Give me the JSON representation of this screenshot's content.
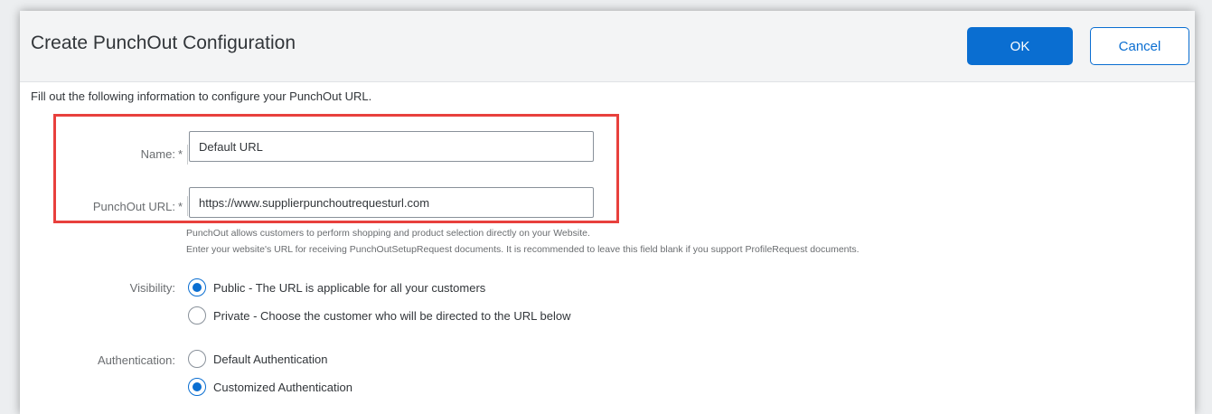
{
  "dialog": {
    "title": "Create PunchOut Configuration",
    "ok_label": "OK",
    "cancel_label": "Cancel"
  },
  "intro_text": "Fill out the following information to configure your PunchOut URL.",
  "form": {
    "required_marker": "*",
    "name": {
      "label": "Name:",
      "value": "Default URL"
    },
    "punchout_url": {
      "label": "PunchOut URL:",
      "value": "https://www.supplierpunchoutrequesturl.com",
      "help_line1": "PunchOut allows customers to perform shopping and product selection directly on your Website.",
      "help_line2": "Enter your website's URL for receiving PunchOutSetupRequest documents. It is recommended to leave this field blank if you support ProfileRequest documents."
    },
    "visibility": {
      "label": "Visibility:",
      "options": [
        {
          "label": "Public - The URL is applicable for all your customers",
          "selected": true
        },
        {
          "label": "Private - Choose the customer who will be directed to the URL below",
          "selected": false
        }
      ]
    },
    "authentication": {
      "label": "Authentication:",
      "options": [
        {
          "label": "Default Authentication",
          "selected": false
        },
        {
          "label": "Customized Authentication",
          "selected": true
        }
      ]
    }
  },
  "colors": {
    "accent": "#0a6ed1",
    "highlight_border": "#e8403d",
    "header_bg": "#f3f4f5"
  }
}
